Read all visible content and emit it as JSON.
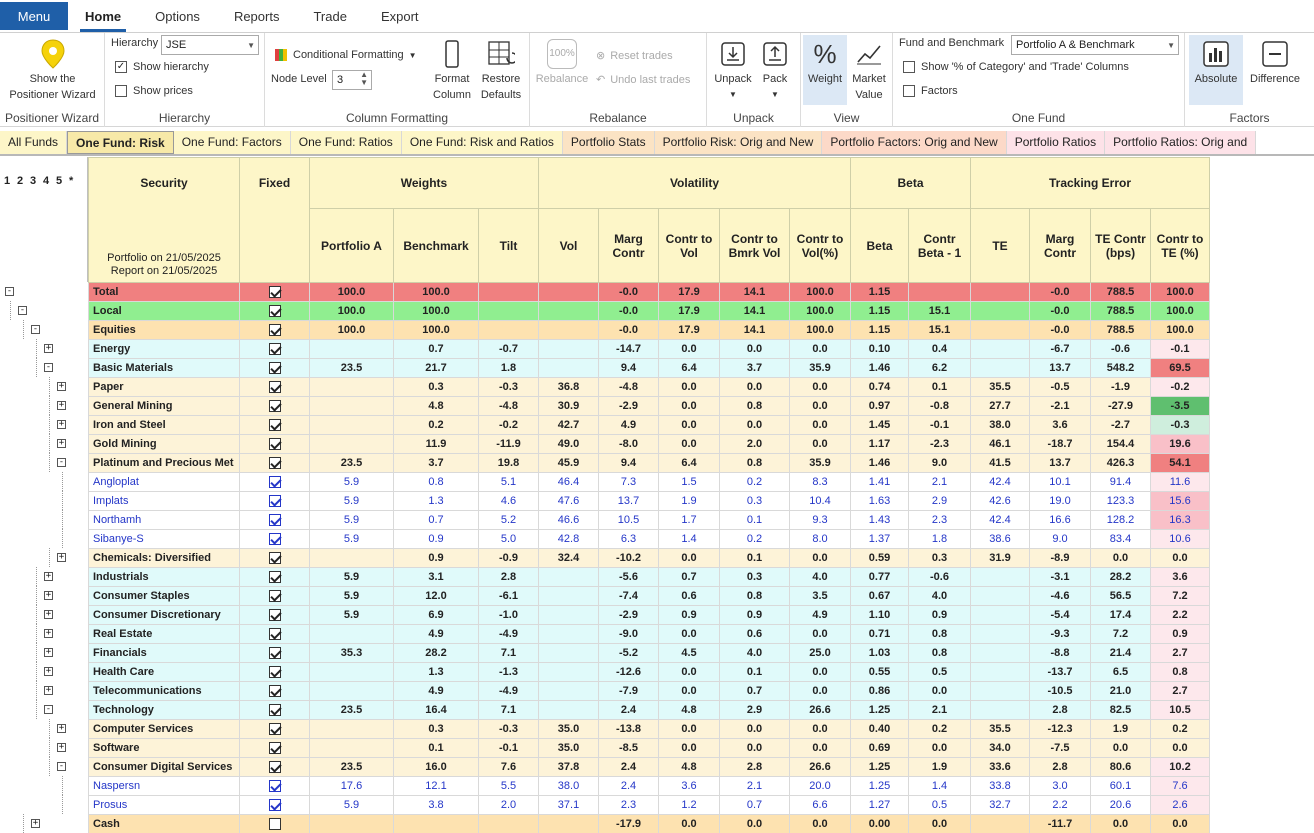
{
  "menubar": {
    "menu_label": "Menu",
    "tabs": [
      "Home",
      "Options",
      "Reports",
      "Trade",
      "Export"
    ]
  },
  "ribbon": {
    "positioner": {
      "button": "Show the Positioner Wizard",
      "group": "Positioner Wizard"
    },
    "hierarchy": {
      "label": "Hierarchy",
      "value": "JSE",
      "show_hierarchy": "Show hierarchy",
      "show_prices": "Show prices",
      "group": "Hierarchy"
    },
    "column_formatting": {
      "conditional": "Conditional Formatting",
      "node_level_label": "Node Level",
      "node_level_value": "3",
      "format_column": "Format Column",
      "restore_defaults": "Restore Defaults",
      "group": "Column Formatting"
    },
    "rebalance": {
      "button": "Rebalance",
      "icon_text": "100%",
      "reset": "Reset trades",
      "undo": "Undo last trades",
      "group": "Rebalance"
    },
    "unpack": {
      "unpack": "Unpack",
      "pack": "Pack",
      "group": "Unpack"
    },
    "view": {
      "weight": "Weight",
      "market_value": "Market Value",
      "group": "View"
    },
    "one_fund": {
      "fund_label": "Fund and Benchmark",
      "fund_value": "Portfolio A & Benchmark",
      "show_cat": "Show '% of Category' and 'Trade' Columns",
      "factors": "Factors",
      "group": "One Fund"
    },
    "factors": {
      "absolute": "Absolute",
      "difference": "Difference",
      "group": "Factors"
    }
  },
  "sheet_tabs": [
    {
      "label": "All Funds",
      "bg": "#fdf6c8"
    },
    {
      "label": "One Fund: Risk",
      "bg": "#f7e9a8"
    },
    {
      "label": "One Fund: Factors",
      "bg": "#fdf6c8"
    },
    {
      "label": "One Fund: Ratios",
      "bg": "#fdf6c8"
    },
    {
      "label": "One Fund: Risk and Ratios",
      "bg": "#fdf6c8"
    },
    {
      "label": "Portfolio Stats",
      "bg": "#fbe3c4"
    },
    {
      "label": "Portfolio Risk: Orig and New",
      "bg": "#fbe3c4"
    },
    {
      "label": "Portfolio Factors: Orig and New",
      "bg": "#fcd9c8"
    },
    {
      "label": "Portfolio Ratios",
      "bg": "#fde2e8"
    },
    {
      "label": "Portfolio Ratios: Orig and",
      "bg": "#fde2e8"
    }
  ],
  "levels": [
    "1",
    "2",
    "3",
    "4",
    "5",
    "*"
  ],
  "header": {
    "security": "Security",
    "fixed": "Fixed",
    "portfolio_on": "Portfolio on 21/05/2025",
    "report_on": "Report on 21/05/2025",
    "groups": [
      "Weights",
      "Volatility",
      "Beta",
      "Tracking Error"
    ],
    "cols": [
      "Portfolio A",
      "Benchmark",
      "Tilt",
      "Vol",
      "Marg Contr",
      "Contr to Vol",
      "Contr to Bmrk Vol",
      "Contr to Vol(%)",
      "Beta",
      "Contr Beta - 1",
      "TE",
      "Marg Contr",
      "TE Contr (bps)",
      "Contr to TE (%)"
    ]
  },
  "colors": {
    "total": "#f08080",
    "local": "#90ee90",
    "equities": "#fde2b0",
    "sector": "#e0fafa",
    "industry": "#fdf3d8",
    "stock": "#ffffff",
    "te_high": "#f08080",
    "te_mid": "#f9c0c8",
    "te_low": "#fde8ec",
    "te_neg": "#5fbf6f",
    "te_neg_light": "#cfeedd"
  },
  "rows": [
    {
      "level": 0,
      "type": "total",
      "node": "-",
      "name": "Total",
      "fixed": true,
      "v": [
        "100.0",
        "100.0",
        "",
        "",
        "-0.0",
        "17.9",
        "14.1",
        "100.0",
        "1.15",
        "",
        "",
        "-0.0",
        "788.5",
        "100.0"
      ],
      "te": ""
    },
    {
      "level": 1,
      "type": "local",
      "node": "-",
      "name": "Local",
      "fixed": true,
      "v": [
        "100.0",
        "100.0",
        "",
        "",
        "-0.0",
        "17.9",
        "14.1",
        "100.0",
        "1.15",
        "15.1",
        "",
        "-0.0",
        "788.5",
        "100.0"
      ],
      "te": ""
    },
    {
      "level": 2,
      "type": "equities",
      "node": "-",
      "name": "Equities",
      "fixed": true,
      "v": [
        "100.0",
        "100.0",
        "",
        "",
        "-0.0",
        "17.9",
        "14.1",
        "100.0",
        "1.15",
        "15.1",
        "",
        "-0.0",
        "788.5",
        "100.0"
      ],
      "te": ""
    },
    {
      "level": 3,
      "type": "sector",
      "node": "+",
      "name": "Energy",
      "fixed": true,
      "v": [
        "",
        "0.7",
        "-0.7",
        "",
        "-14.7",
        "0.0",
        "0.0",
        "0.0",
        "0.10",
        "0.4",
        "",
        "-6.7",
        "-0.6",
        "-0.1"
      ],
      "te": "low"
    },
    {
      "level": 3,
      "type": "sector",
      "node": "-",
      "name": "Basic Materials",
      "fixed": true,
      "v": [
        "23.5",
        "21.7",
        "1.8",
        "",
        "9.4",
        "6.4",
        "3.7",
        "35.9",
        "1.46",
        "6.2",
        "",
        "13.7",
        "548.2",
        "69.5"
      ],
      "te": "high"
    },
    {
      "level": 4,
      "type": "industry",
      "node": "+",
      "name": "Paper",
      "fixed": true,
      "v": [
        "",
        "0.3",
        "-0.3",
        "36.8",
        "-4.8",
        "0.0",
        "0.0",
        "0.0",
        "0.74",
        "0.1",
        "35.5",
        "-0.5",
        "-1.9",
        "-0.2"
      ],
      "te": "low"
    },
    {
      "level": 4,
      "type": "industry",
      "node": "+",
      "name": "General Mining",
      "fixed": true,
      "v": [
        "",
        "4.8",
        "-4.8",
        "30.9",
        "-2.9",
        "0.0",
        "0.8",
        "0.0",
        "0.97",
        "-0.8",
        "27.7",
        "-2.1",
        "-27.9",
        "-3.5"
      ],
      "te": "neg"
    },
    {
      "level": 4,
      "type": "industry",
      "node": "+",
      "name": "Iron and Steel",
      "fixed": true,
      "v": [
        "",
        "0.2",
        "-0.2",
        "42.7",
        "4.9",
        "0.0",
        "0.0",
        "0.0",
        "1.45",
        "-0.1",
        "38.0",
        "3.6",
        "-2.7",
        "-0.3"
      ],
      "te": "neg_light"
    },
    {
      "level": 4,
      "type": "industry",
      "node": "+",
      "name": "Gold Mining",
      "fixed": true,
      "v": [
        "",
        "11.9",
        "-11.9",
        "49.0",
        "-8.0",
        "0.0",
        "2.0",
        "0.0",
        "1.17",
        "-2.3",
        "46.1",
        "-18.7",
        "154.4",
        "19.6"
      ],
      "te": "mid"
    },
    {
      "level": 4,
      "type": "industry",
      "node": "-",
      "name": "Platinum and Precious Met",
      "fixed": true,
      "v": [
        "23.5",
        "3.7",
        "19.8",
        "45.9",
        "9.4",
        "6.4",
        "0.8",
        "35.9",
        "1.46",
        "9.0",
        "41.5",
        "13.7",
        "426.3",
        "54.1"
      ],
      "te": "high"
    },
    {
      "level": 5,
      "type": "stock",
      "node": "",
      "name": "Angloplat",
      "fixed": true,
      "v": [
        "5.9",
        "0.8",
        "5.1",
        "46.4",
        "7.3",
        "1.5",
        "0.2",
        "8.3",
        "1.41",
        "2.1",
        "42.4",
        "10.1",
        "91.4",
        "11.6"
      ],
      "te": "low"
    },
    {
      "level": 5,
      "type": "stock",
      "node": "",
      "name": "Implats",
      "fixed": true,
      "v": [
        "5.9",
        "1.3",
        "4.6",
        "47.6",
        "13.7",
        "1.9",
        "0.3",
        "10.4",
        "1.63",
        "2.9",
        "42.6",
        "19.0",
        "123.3",
        "15.6"
      ],
      "te": "mid"
    },
    {
      "level": 5,
      "type": "stock",
      "node": "",
      "name": "Northamh",
      "fixed": true,
      "v": [
        "5.9",
        "0.7",
        "5.2",
        "46.6",
        "10.5",
        "1.7",
        "0.1",
        "9.3",
        "1.43",
        "2.3",
        "42.4",
        "16.6",
        "128.2",
        "16.3"
      ],
      "te": "mid"
    },
    {
      "level": 5,
      "type": "stock",
      "node": "",
      "name": "Sibanye-S",
      "fixed": true,
      "v": [
        "5.9",
        "0.9",
        "5.0",
        "42.8",
        "6.3",
        "1.4",
        "0.2",
        "8.0",
        "1.37",
        "1.8",
        "38.6",
        "9.0",
        "83.4",
        "10.6"
      ],
      "te": "low"
    },
    {
      "level": 4,
      "type": "industry",
      "node": "+",
      "name": "Chemicals: Diversified",
      "fixed": true,
      "v": [
        "",
        "0.9",
        "-0.9",
        "32.4",
        "-10.2",
        "0.0",
        "0.1",
        "0.0",
        "0.59",
        "0.3",
        "31.9",
        "-8.9",
        "0.0",
        "0.0"
      ],
      "te": ""
    },
    {
      "level": 3,
      "type": "sector",
      "node": "+",
      "name": "Industrials",
      "fixed": true,
      "v": [
        "5.9",
        "3.1",
        "2.8",
        "",
        "-5.6",
        "0.7",
        "0.3",
        "4.0",
        "0.77",
        "-0.6",
        "",
        "-3.1",
        "28.2",
        "3.6"
      ],
      "te": "low"
    },
    {
      "level": 3,
      "type": "sector",
      "node": "+",
      "name": "Consumer Staples",
      "fixed": true,
      "v": [
        "5.9",
        "12.0",
        "-6.1",
        "",
        "-7.4",
        "0.6",
        "0.8",
        "3.5",
        "0.67",
        "4.0",
        "",
        "-4.6",
        "56.5",
        "7.2"
      ],
      "te": "low"
    },
    {
      "level": 3,
      "type": "sector",
      "node": "+",
      "name": "Consumer Discretionary",
      "fixed": true,
      "v": [
        "5.9",
        "6.9",
        "-1.0",
        "",
        "-2.9",
        "0.9",
        "0.9",
        "4.9",
        "1.10",
        "0.9",
        "",
        "-5.4",
        "17.4",
        "2.2"
      ],
      "te": "low"
    },
    {
      "level": 3,
      "type": "sector",
      "node": "+",
      "name": "Real Estate",
      "fixed": true,
      "v": [
        "",
        "4.9",
        "-4.9",
        "",
        "-9.0",
        "0.0",
        "0.6",
        "0.0",
        "0.71",
        "0.8",
        "",
        "-9.3",
        "7.2",
        "0.9"
      ],
      "te": "low"
    },
    {
      "level": 3,
      "type": "sector",
      "node": "+",
      "name": "Financials",
      "fixed": true,
      "v": [
        "35.3",
        "28.2",
        "7.1",
        "",
        "-5.2",
        "4.5",
        "4.0",
        "25.0",
        "1.03",
        "0.8",
        "",
        "-8.8",
        "21.4",
        "2.7"
      ],
      "te": "low"
    },
    {
      "level": 3,
      "type": "sector",
      "node": "+",
      "name": "Health Care",
      "fixed": true,
      "v": [
        "",
        "1.3",
        "-1.3",
        "",
        "-12.6",
        "0.0",
        "0.1",
        "0.0",
        "0.55",
        "0.5",
        "",
        "-13.7",
        "6.5",
        "0.8"
      ],
      "te": "low"
    },
    {
      "level": 3,
      "type": "sector",
      "node": "+",
      "name": "Telecommunications",
      "fixed": true,
      "v": [
        "",
        "4.9",
        "-4.9",
        "",
        "-7.9",
        "0.0",
        "0.7",
        "0.0",
        "0.86",
        "0.0",
        "",
        "-10.5",
        "21.0",
        "2.7"
      ],
      "te": "low"
    },
    {
      "level": 3,
      "type": "sector",
      "node": "-",
      "name": "Technology",
      "fixed": true,
      "v": [
        "23.5",
        "16.4",
        "7.1",
        "",
        "2.4",
        "4.8",
        "2.9",
        "26.6",
        "1.25",
        "2.1",
        "",
        "2.8",
        "82.5",
        "10.5"
      ],
      "te": "low"
    },
    {
      "level": 4,
      "type": "industry",
      "node": "+",
      "name": "Computer Services",
      "fixed": true,
      "v": [
        "",
        "0.3",
        "-0.3",
        "35.0",
        "-13.8",
        "0.0",
        "0.0",
        "0.0",
        "0.40",
        "0.2",
        "35.5",
        "-12.3",
        "1.9",
        "0.2"
      ],
      "te": ""
    },
    {
      "level": 4,
      "type": "industry",
      "node": "+",
      "name": "Software",
      "fixed": true,
      "v": [
        "",
        "0.1",
        "-0.1",
        "35.0",
        "-8.5",
        "0.0",
        "0.0",
        "0.0",
        "0.69",
        "0.0",
        "34.0",
        "-7.5",
        "0.0",
        "0.0"
      ],
      "te": ""
    },
    {
      "level": 4,
      "type": "industry",
      "node": "-",
      "name": "Consumer Digital Services",
      "fixed": true,
      "v": [
        "23.5",
        "16.0",
        "7.6",
        "37.8",
        "2.4",
        "4.8",
        "2.8",
        "26.6",
        "1.25",
        "1.9",
        "33.6",
        "2.8",
        "80.6",
        "10.2"
      ],
      "te": "low"
    },
    {
      "level": 5,
      "type": "stock",
      "node": "",
      "name": "Naspersn",
      "fixed": true,
      "v": [
        "17.6",
        "12.1",
        "5.5",
        "38.0",
        "2.4",
        "3.6",
        "2.1",
        "20.0",
        "1.25",
        "1.4",
        "33.8",
        "3.0",
        "60.1",
        "7.6"
      ],
      "te": "low"
    },
    {
      "level": 5,
      "type": "stock",
      "node": "",
      "name": "Prosus",
      "fixed": true,
      "v": [
        "5.9",
        "3.8",
        "2.0",
        "37.1",
        "2.3",
        "1.2",
        "0.7",
        "6.6",
        "1.27",
        "0.5",
        "32.7",
        "2.2",
        "20.6",
        "2.6"
      ],
      "te": "low"
    },
    {
      "level": 2,
      "type": "equities",
      "node": "+",
      "name": "Cash",
      "fixed": false,
      "v": [
        "",
        "",
        "",
        "",
        "-17.9",
        "0.0",
        "0.0",
        "0.0",
        "0.00",
        "0.0",
        "",
        "-11.7",
        "0.0",
        "0.0"
      ],
      "te": ""
    }
  ]
}
